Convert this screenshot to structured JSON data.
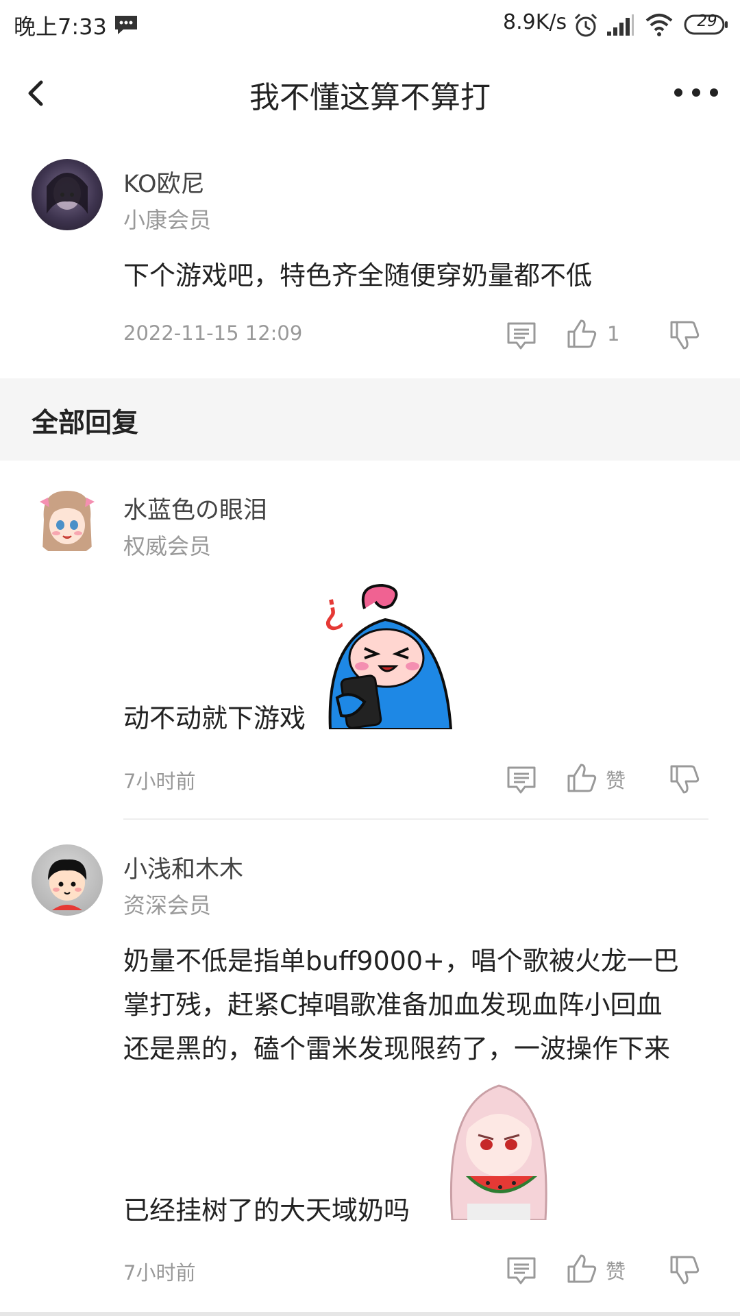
{
  "status_bar": {
    "time": "晚上7:33",
    "net_speed": "8.9K/s",
    "battery": "29",
    "icons": [
      "message-icon",
      "alarm-icon",
      "signal-icon",
      "wifi-icon",
      "battery-icon"
    ]
  },
  "nav": {
    "title": "我不懂这算不算打",
    "back_icon": "chevron-left-icon",
    "more_icon": "more-icon"
  },
  "main_comment": {
    "user": "KO欧尼",
    "level": "小康会员",
    "text": "下个游戏吧，特色齐全随便穿奶量都不低",
    "time": "2022-11-15 12:09",
    "like_count": "1"
  },
  "section": {
    "title": "全部回复"
  },
  "replies": [
    {
      "user": "水蓝色の眼泪",
      "level": "权威会员",
      "text": "动不动就下游戏",
      "time": "7小时前",
      "like_label": "赞"
    },
    {
      "user": "小浅和木木",
      "level": "资深会员",
      "text_lines": [
        "奶量不低是指单buff9000+，唱个歌被火龙一巴",
        "掌打残，赶紧C掉唱歌准备加血发现血阵小回血",
        "还是黑的，磕个雷米发现限药了，一波操作下来",
        "已经挂树了的大天域奶吗"
      ],
      "time": "7小时前",
      "like_label": "赞"
    }
  ],
  "colors": {
    "text_primary": "#222222",
    "text_secondary": "#999999",
    "section_bg": "#f5f5f5",
    "divider": "#eeeeee"
  }
}
